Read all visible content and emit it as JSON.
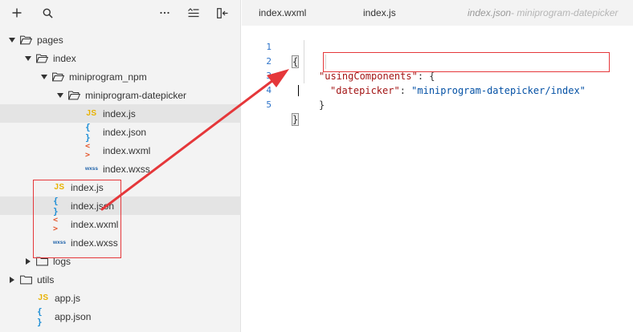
{
  "toolbar": {
    "add_icon": "plus-icon",
    "search_icon": "search-icon",
    "more_icon": "ellipsis-icon",
    "collapse_icon": "collapse-all-icon",
    "split_icon": "collapse-panel-icon"
  },
  "tree": [
    {
      "label": "pages",
      "type": "folder",
      "depth": 0,
      "expanded": true
    },
    {
      "label": "index",
      "type": "folder",
      "depth": 1,
      "expanded": true
    },
    {
      "label": "miniprogram_npm",
      "type": "folder",
      "depth": 2,
      "expanded": true
    },
    {
      "label": "miniprogram-datepicker",
      "type": "folder",
      "depth": 3,
      "expanded": true
    },
    {
      "label": "index.js",
      "type": "js",
      "depth": 4,
      "selected": true
    },
    {
      "label": "index.json",
      "type": "json",
      "depth": 4
    },
    {
      "label": "index.wxml",
      "type": "wxml",
      "depth": 4
    },
    {
      "label": "index.wxss",
      "type": "wxss",
      "depth": 4
    },
    {
      "label": "index.js",
      "type": "js",
      "depth": 2
    },
    {
      "label": "index.json",
      "type": "json",
      "depth": 2,
      "selected": true
    },
    {
      "label": "index.wxml",
      "type": "wxml",
      "depth": 2
    },
    {
      "label": "index.wxss",
      "type": "wxss",
      "depth": 2
    },
    {
      "label": "logs",
      "type": "folder",
      "depth": 1,
      "expanded": false
    },
    {
      "label": "utils",
      "type": "folder",
      "depth": 0,
      "expanded": false
    },
    {
      "label": "app.js",
      "type": "js",
      "depth": 1
    },
    {
      "label": "app.json",
      "type": "json",
      "depth": 1
    }
  ],
  "file_icon_glyphs": {
    "js": "JS",
    "json": "{ }",
    "wxml": "< >",
    "wxss": "wxss"
  },
  "tabs": [
    {
      "label": "index.wxml"
    },
    {
      "label": "index.js"
    },
    {
      "label": "index.json",
      "sub": " - miniprogram-datepicker",
      "active": true
    }
  ],
  "code": {
    "line_numbers": [
      "1",
      "2",
      "3",
      "4",
      "5"
    ],
    "l1_open": "{",
    "l2_key": "\"usingComponents\"",
    "l2_colon": ": {",
    "l3_key": "\"datepicker\"",
    "l3_colon": ": ",
    "l3_value": "\"miniprogram-datepicker/index\"",
    "l4_close": "}",
    "l5_close": "}"
  },
  "colors": {
    "annotation_red": "#e5373a",
    "json_key": "#a31515",
    "json_string": "#0451a5",
    "line_number": "#2b72c9"
  }
}
